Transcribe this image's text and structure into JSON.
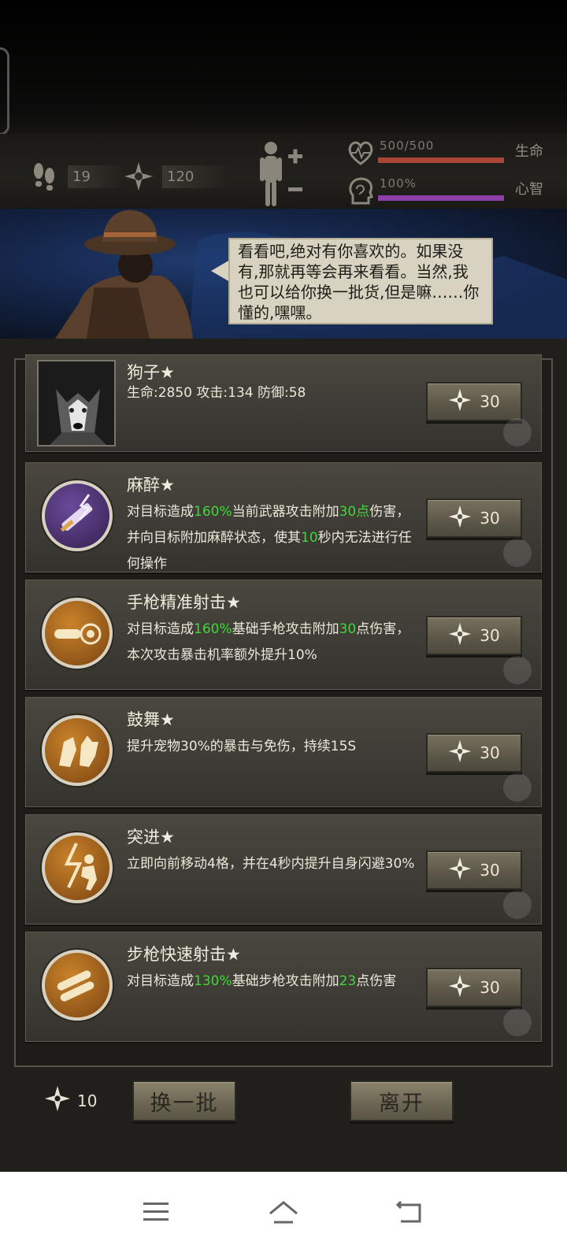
{
  "top_stats": {
    "steps": "19",
    "crystals": "120"
  },
  "vitals": {
    "health_text": "500/500",
    "health_label": "生命",
    "health_fraction": 1.0,
    "health_color": "#a8463a",
    "sanity_text": "100%",
    "sanity_label": "心智",
    "sanity_fraction": 1.0,
    "sanity_color": "#8a3ea8"
  },
  "merchant": {
    "speech": "看看吧,绝对有你喜欢的。如果没有,那就再等会再来看看。当然,我也可以给你换一批货,但是嘛……你懂的,嘿嘿。"
  },
  "items": [
    {
      "title": "狗子★",
      "icon": "husky-dog-portrait",
      "desc": [
        {
          "t": "生命:2850  攻击:134  防御:58",
          "hl": false
        }
      ],
      "price": "30"
    },
    {
      "title": "麻醉★",
      "icon": "syringe-icon",
      "desc": [
        {
          "t": "对目标造成",
          "hl": false
        },
        {
          "t": "160%",
          "hl": true
        },
        {
          "t": "当前武器攻击附加",
          "hl": false
        },
        {
          "t": "30点",
          "hl": true
        },
        {
          "t": "伤害，并向目标附加麻醉状态，使其",
          "hl": false
        },
        {
          "t": "10",
          "hl": true
        },
        {
          "t": "秒内无法进行任何操作",
          "hl": false
        }
      ],
      "price": "30"
    },
    {
      "title": "手枪精准射击★",
      "icon": "bullet-target-icon",
      "desc": [
        {
          "t": "对目标造成",
          "hl": false
        },
        {
          "t": "160%",
          "hl": true
        },
        {
          "t": "基础手枪攻击附加",
          "hl": false
        },
        {
          "t": "30",
          "hl": true
        },
        {
          "t": "点伤害，本次攻击暴击机率额外提升10%",
          "hl": false
        }
      ],
      "price": "30"
    },
    {
      "title": "鼓舞★",
      "icon": "pet-encourage-icon",
      "desc": [
        {
          "t": "提升宠物30%的暴击与免伤，持续15S",
          "hl": false
        }
      ],
      "price": "30"
    },
    {
      "title": "突进★",
      "icon": "dash-runner-icon",
      "desc": [
        {
          "t": "立即向前移动4格，并在4秒内提升自身闪避30%",
          "hl": false
        }
      ],
      "price": "30"
    },
    {
      "title": "步枪快速射击★",
      "icon": "rifle-bullets-icon",
      "desc": [
        {
          "t": "对目标造成",
          "hl": false
        },
        {
          "t": "130%",
          "hl": true
        },
        {
          "t": "基础步枪攻击附加",
          "hl": false
        },
        {
          "t": "23",
          "hl": true
        },
        {
          "t": "点伤害",
          "hl": false
        }
      ],
      "price": "30"
    }
  ],
  "footer": {
    "crystals": "10",
    "refresh_label": "换一批",
    "leave_label": "离开"
  }
}
